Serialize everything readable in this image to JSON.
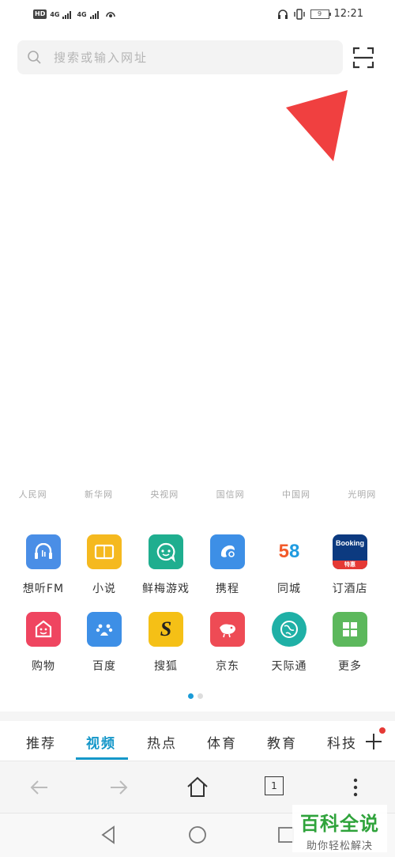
{
  "status_bar": {
    "hd_label": "HD",
    "signal1": "4G",
    "signal2": "4G",
    "battery_level": "9",
    "time": "12:21"
  },
  "search": {
    "placeholder": "搜索或输入网址"
  },
  "news_sites": [
    "人民网",
    "新华网",
    "央视网",
    "国信网",
    "中国网",
    "光明网"
  ],
  "apps": [
    {
      "label": "想听FM",
      "icon": "headphones-icon",
      "color": "#4a8ee6"
    },
    {
      "label": "小说",
      "icon": "book-icon",
      "color": "#f5b91f"
    },
    {
      "label": "鲜梅游戏",
      "icon": "game-face-icon",
      "color": "#1fae8f"
    },
    {
      "label": "携程",
      "icon": "dolphin-icon",
      "color": "#3d8fe6"
    },
    {
      "label": "同城",
      "icon": "58-logo",
      "color": "#ffffff",
      "text": "58"
    },
    {
      "label": "订酒店",
      "icon": "booking-logo",
      "color": "#0c3a80",
      "text": "Booking",
      "badge": "特惠"
    },
    {
      "label": "购物",
      "icon": "smile-bag-icon",
      "color": "#ef4560"
    },
    {
      "label": "百度",
      "icon": "paw-icon",
      "color": "#3d8fe6"
    },
    {
      "label": "搜狐",
      "icon": "sohu-logo",
      "color": "#f5c016",
      "text": "S"
    },
    {
      "label": "京东",
      "icon": "jd-dog-icon",
      "color": "#ee4b55"
    },
    {
      "label": "天际通",
      "icon": "globe-icon",
      "color": "#1fb0a6"
    },
    {
      "label": "更多",
      "icon": "grid-icon",
      "color": "#5cb85c"
    }
  ],
  "tabs": [
    "推荐",
    "视频",
    "热点",
    "体育",
    "教育",
    "科技"
  ],
  "active_tab": "视频",
  "tab_count": "1",
  "watermark": {
    "main": "百科全说",
    "sub": "助你轻松解决"
  },
  "colors": {
    "accent": "#1597c9",
    "arrow": "#f04040"
  }
}
